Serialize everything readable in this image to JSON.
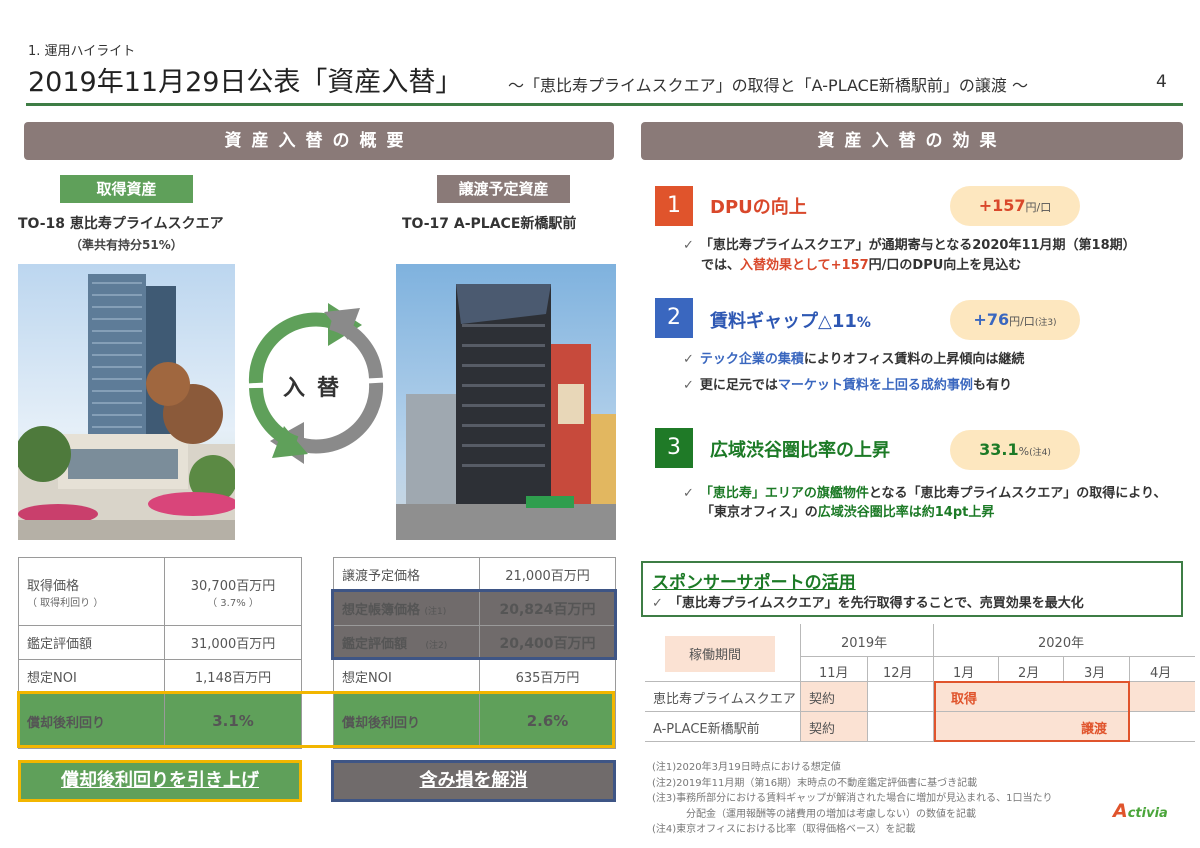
{
  "header": {
    "section": "1. 運用ハイライト",
    "title": "2019年11月29日公表「資産入替」",
    "subtitle": "～「恵比寿プライムスクエア」の取得と「A-PLACE新橋駅前」の譲渡 ～",
    "page_number": "4"
  },
  "left": {
    "banner": "資産入替の概要",
    "acquired": {
      "tag": "取得資産",
      "name": "TO-18 恵比寿プライムスクエア",
      "sub": "（準共有持分51%）",
      "rows": [
        {
          "label": "取得価格",
          "label_sub": "（ 取得利回り ）",
          "value": "30,700百万円",
          "value_sub": "（ 3.7% ）"
        },
        {
          "label": "鑑定評価額",
          "value": "31,000百万円"
        },
        {
          "label": "想定NOI",
          "value": "1,148百万円"
        },
        {
          "label": "償却後利回り",
          "value": "3.1%"
        }
      ],
      "button": "償却後利回りを引き上げ"
    },
    "transferred": {
      "tag": "譲渡予定資産",
      "name": "TO-17 A-PLACE新橋駅前",
      "rows": [
        {
          "label": "譲渡予定価格",
          "value": "21,000百万円"
        },
        {
          "label": "想定帳簿価格",
          "note": "(注1)",
          "value": "20,824百万円"
        },
        {
          "label": "鑑定評価額",
          "note": "(注2)",
          "value": "20,400百万円"
        },
        {
          "label": "想定NOI",
          "value": "635百万円"
        },
        {
          "label": "償却後利回り",
          "value": "2.6%"
        }
      ],
      "button": "含み損を解消"
    },
    "swap_label": "入替"
  },
  "right": {
    "banner": "資産入替の効果",
    "effects": [
      {
        "num": "1",
        "title": "DPUの向上",
        "value": "+157",
        "unit": "円/口",
        "note": "",
        "bullets": [
          [
            "「恵比寿プライムスクエア」が通期寄与となる2020年11月期（第18期）"
          ],
          [
            "では、",
            "入替効果として+157",
            "円/口のDPU向上を見込む"
          ]
        ]
      },
      {
        "num": "2",
        "title": "賃料ギャップ△11",
        "title_suffix": "%",
        "value": "+76",
        "unit": "円/口",
        "note": "(注3)",
        "bullets": [
          [
            "テック企業の集積",
            "によりオフィス賃料の上昇傾向は継続"
          ],
          [
            "更に足元では",
            "マーケット賃料を上回る成約事例",
            "も有り"
          ]
        ]
      },
      {
        "num": "3",
        "title": "広域渋谷圏比率の上昇",
        "value": "33.1",
        "unit": "%",
        "note": "(注4)",
        "bullets": [
          [
            "「恵比寿」エリアの旗艦物件",
            "となる「恵比寿プライムスクエア」の取得により、"
          ],
          [
            "「東京オフィス」の",
            "広域渋谷圏比率は約14pt上昇"
          ]
        ]
      }
    ],
    "sponsor": {
      "title": "スポンサーサポートの活用",
      "desc": "「恵比寿プライムスクエア」を先行取得することで、売買効果を最大化"
    },
    "schedule": {
      "period_label": "稼働期間",
      "years": [
        "2019年",
        "2020年"
      ],
      "months": [
        "11月",
        "12月",
        "1月",
        "2月",
        "3月",
        "4月"
      ],
      "rows": [
        {
          "name": "恵比寿プライムスクエア",
          "contract": "契約",
          "event": "取得"
        },
        {
          "name": "A-PLACE新橋駅前",
          "contract": "契約",
          "event": "譲渡"
        }
      ]
    },
    "notes": [
      "(注1)2020年3月19日時点における想定値",
      "(注2)2019年11月期（第16期）末時点の不動産鑑定評価書に基づき記載",
      "(注3)事務所部分における賃料ギャップが解消された場合に増加が見込まれる、1口当たり",
      "分配金（運用報酬等の諸費用の増加は考慮しない）の数値を記載",
      "(注4)東京オフィスにおける比率（取得価格ベース）を記載"
    ],
    "logo_initial": "A",
    "logo_rest": "ctivia"
  },
  "colors": {
    "accent_green": "#3e7d45",
    "banner_gray": "#8a7a78",
    "red": "#e0542c",
    "blue": "#3a67bf",
    "dark_green": "#1f7a27",
    "yellow_border": "#f2b600",
    "navy_border": "#3e5585"
  }
}
